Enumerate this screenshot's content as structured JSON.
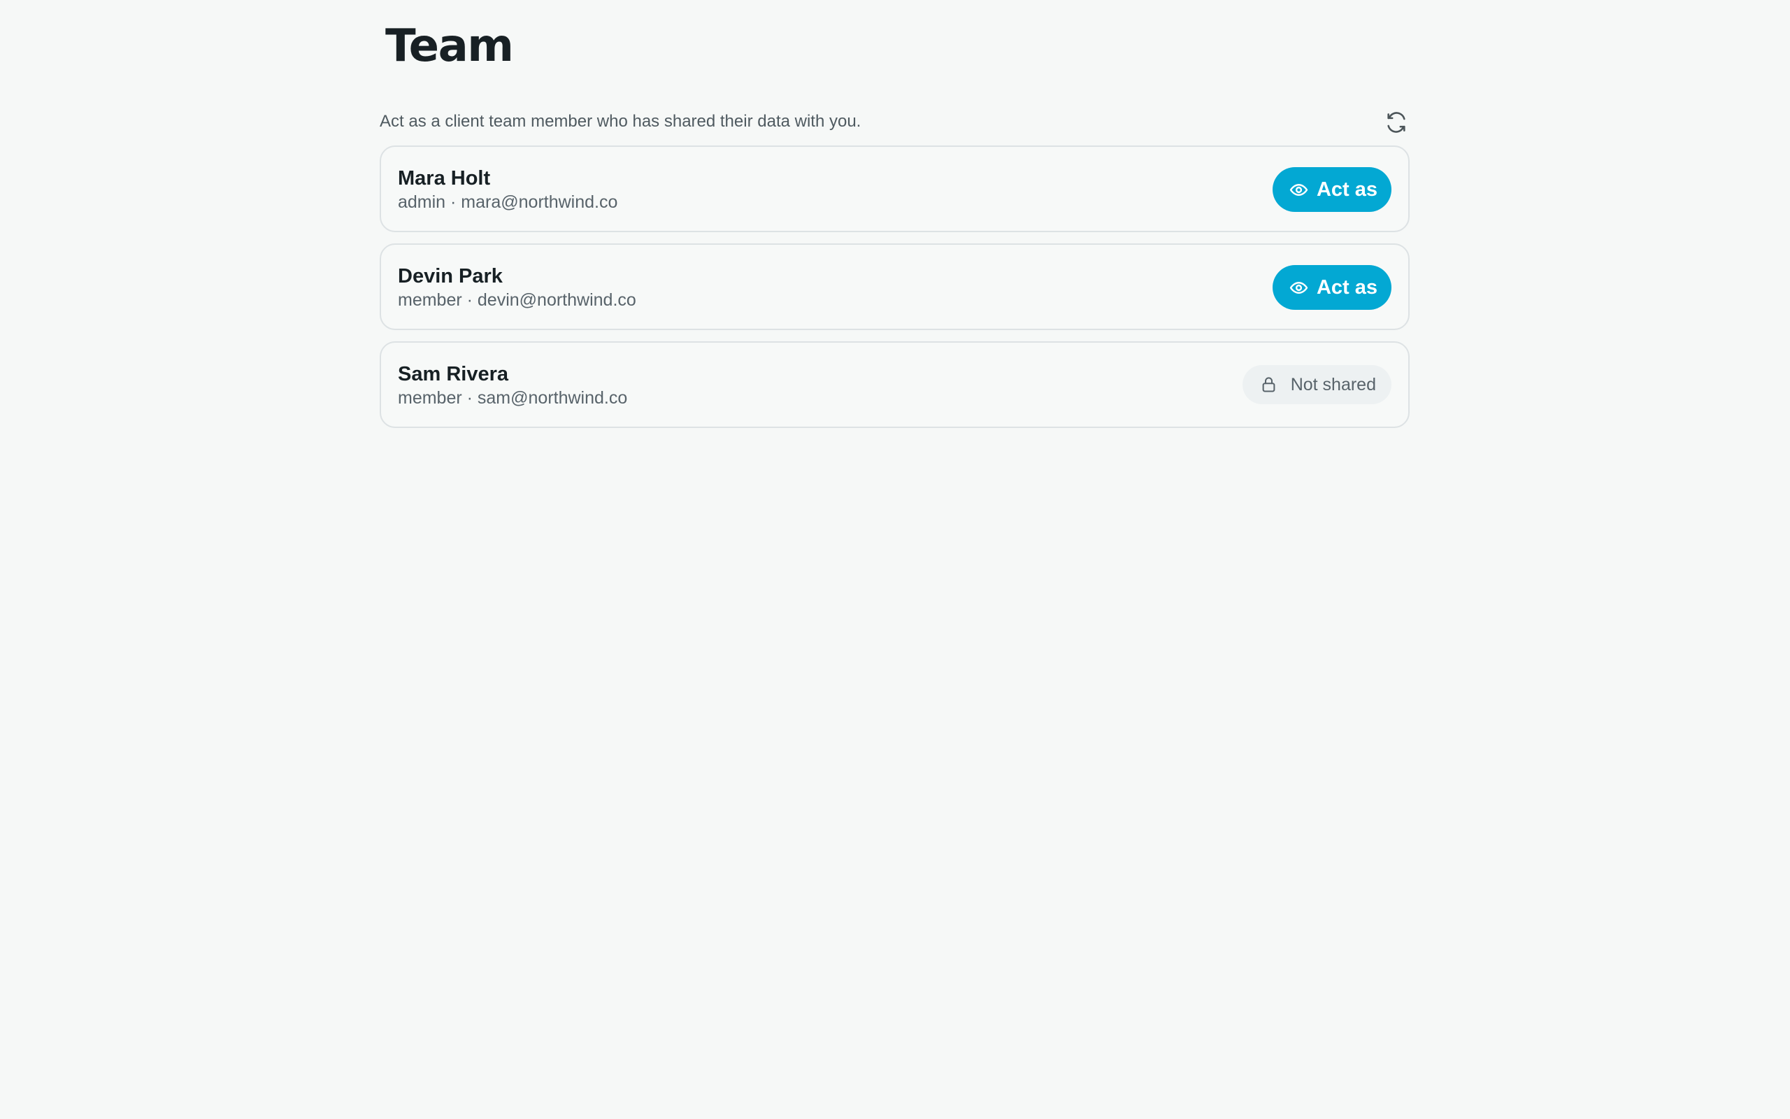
{
  "page": {
    "title": "Team",
    "subtitle": "Act as a client team member who has shared their data with you."
  },
  "icons": {
    "refresh": "refresh-icon",
    "act_as": "eye-icon",
    "not_shared": "lock-icon"
  },
  "colors": {
    "accent": "#03a8d3",
    "background": "#f6f8f7",
    "card_border": "#dde2e4",
    "muted_text": "#58636a"
  },
  "members": [
    {
      "name": "Mara Holt",
      "meta": "admin · mara@northwind.co",
      "action_label": "Act as"
    },
    {
      "name": "Devin Park",
      "meta": "member · devin@northwind.co",
      "action_label": "Act as"
    },
    {
      "name": "Sam Rivera",
      "meta": "member · sam@northwind.co",
      "status_label": "Not shared"
    }
  ]
}
